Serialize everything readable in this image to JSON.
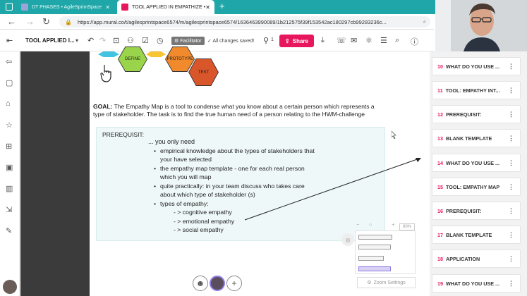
{
  "browser": {
    "tabs": [
      {
        "title": "DT PHASES • AgileSprintSpace",
        "favicon_color": "#9aa4d6",
        "active": false
      },
      {
        "title": "TOOL APPLIED IN EMPATHIZE •",
        "favicon_color": "#e8175d",
        "active": true
      }
    ],
    "url": "https://app.mural.co/t/agilesprintspace6574/m/agilesprintspace6574/1636463990089/1b212575f39f153542ac180297cb99283236c..."
  },
  "toolbar": {
    "mural_title": "TOOL APPLIED I...",
    "facilitator_label": "Facilitator",
    "saved_status": "All changes saved!",
    "member_count": "1",
    "share_label": "Share"
  },
  "canvas": {
    "hexagons": [
      {
        "label": "DEFINE",
        "color": "#9ad44b"
      },
      {
        "label": "PROTOTYPE",
        "color": "#f08a2c"
      },
      {
        "label": "TEST",
        "color": "#d9562a"
      }
    ],
    "goal_label": "GOAL:",
    "goal_text": "The Empathy Map is a tool to condense what you know about a certain person which represents a type of stakeholder. The task is to find the true human need of a person relating to the HWM-challenge",
    "prereq_title": "PREREQUISIT:",
    "prereq_intro": "... you only need",
    "bullets": [
      {
        "line1": "empirical knowledge about the types of stakeholders that",
        "line2": "your have selected"
      },
      {
        "line1": "the empathy map template - one for each real person",
        "line2": "which you will map"
      },
      {
        "line1": "quite practically: in your team discuss who takes care",
        "line2": "about which type of stakeholder (s)"
      },
      {
        "line1": "types of empathy:",
        "line2": ""
      }
    ],
    "sub_bullets": [
      "- > cognitive empathy",
      "- > emotional empathy",
      "- > social empathy"
    ]
  },
  "minimap": {
    "zoom_percent": "60%",
    "zoom_settings_label": "Zoom Settings"
  },
  "outline": {
    "items": [
      {
        "num": "10",
        "label": "WHAT DO YOU USE ..."
      },
      {
        "num": "11",
        "label": "TOOL: EMPATHY INT..."
      },
      {
        "num": "12",
        "label": "PREREQUISIT:"
      },
      {
        "num": "13",
        "label": "BLANK TEMPLATE"
      },
      {
        "num": "14",
        "label": "WHAT DO YOU USE ..."
      },
      {
        "num": "15",
        "label": "TOOL: EMPATHY MAP"
      },
      {
        "num": "16",
        "label": "PREREQUISIT:"
      },
      {
        "num": "17",
        "label": "BLANK TEMPLATE"
      },
      {
        "num": "18",
        "label": "APPLICATION"
      },
      {
        "num": "19",
        "label": "WHAT DO YOU USE ..."
      }
    ]
  },
  "colors": {
    "tabbar": "#1fa6a8",
    "accent": "#e8175d",
    "canvas_box": "#eef8f8"
  }
}
